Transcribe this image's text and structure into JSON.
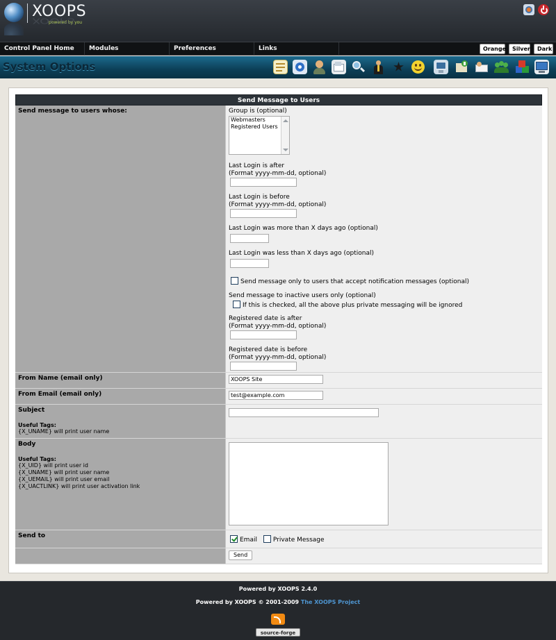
{
  "header": {
    "logo_text": "XOOPS",
    "logo_tagline": "powered by you"
  },
  "nav": {
    "items": [
      "Control Panel Home",
      "Modules",
      "Preferences",
      "Links"
    ],
    "themes": [
      "Orange",
      "Silver",
      "Dark"
    ]
  },
  "titlebar": {
    "title": "System Options",
    "icons": [
      "notepad-icon",
      "blocks-icon",
      "avatar-icon",
      "comments-icon",
      "find-users-icon",
      "users-icon",
      "ranks-icon",
      "smilies-icon",
      "preferences-icon",
      "images-icon",
      "mail-users-icon",
      "groups-icon",
      "modules-icon",
      "templates-icon"
    ]
  },
  "form": {
    "header": "Send Message to Users",
    "criteria_label": "Send message to users whose:",
    "group_label": "Group is (optional)",
    "group_options": [
      "Webmasters",
      "Registered Users"
    ],
    "login_after_label": "Last Login is after",
    "login_after_format": "(Format yyyy-mm-dd, optional)",
    "login_before_label": "Last Login is before",
    "login_before_format": "(Format yyyy-mm-dd, optional)",
    "login_more_label": "Last Login was more than X days ago (optional)",
    "login_less_label": "Last Login was less than X days ago (optional)",
    "notify_label": "Send message only to users that accept notification messages (optional)",
    "inactive_label": "Send message to inactive users only (optional)",
    "inactive_check_label": "If this is checked, all the above plus private messaging will be ignored",
    "reg_after_label": "Registered date is after",
    "reg_after_format": "(Format yyyy-mm-dd, optional)",
    "reg_before_label": "Registered date is before",
    "reg_before_format": "(Format yyyy-mm-dd, optional)",
    "from_name_label": "From Name (email only)",
    "from_name_value": "XOOPS Site",
    "from_email_label": "From Email (email only)",
    "from_email_value": "test@example.com",
    "subject_label": "Subject",
    "subject_useful": "Useful Tags:",
    "subject_tags": [
      "{X_UNAME} will print user name"
    ],
    "body_label": "Body",
    "body_useful": "Useful Tags:",
    "body_tags": [
      "{X_UID} will print user id",
      "{X_UNAME} will print user name",
      "{X_UEMAIL} will print user email",
      "{X_UACTLINK} will print user activation link"
    ],
    "send_to_label": "Send to",
    "send_email_label": "Email",
    "send_pm_label": "Private Message",
    "send_button": "Send"
  },
  "footer": {
    "powered": "Powered by XOOPS 2.4.0",
    "copyright": "Powered by XOOPS © 2001-2009",
    "project_link": "The XOOPS Project",
    "badge": "source-forge"
  }
}
